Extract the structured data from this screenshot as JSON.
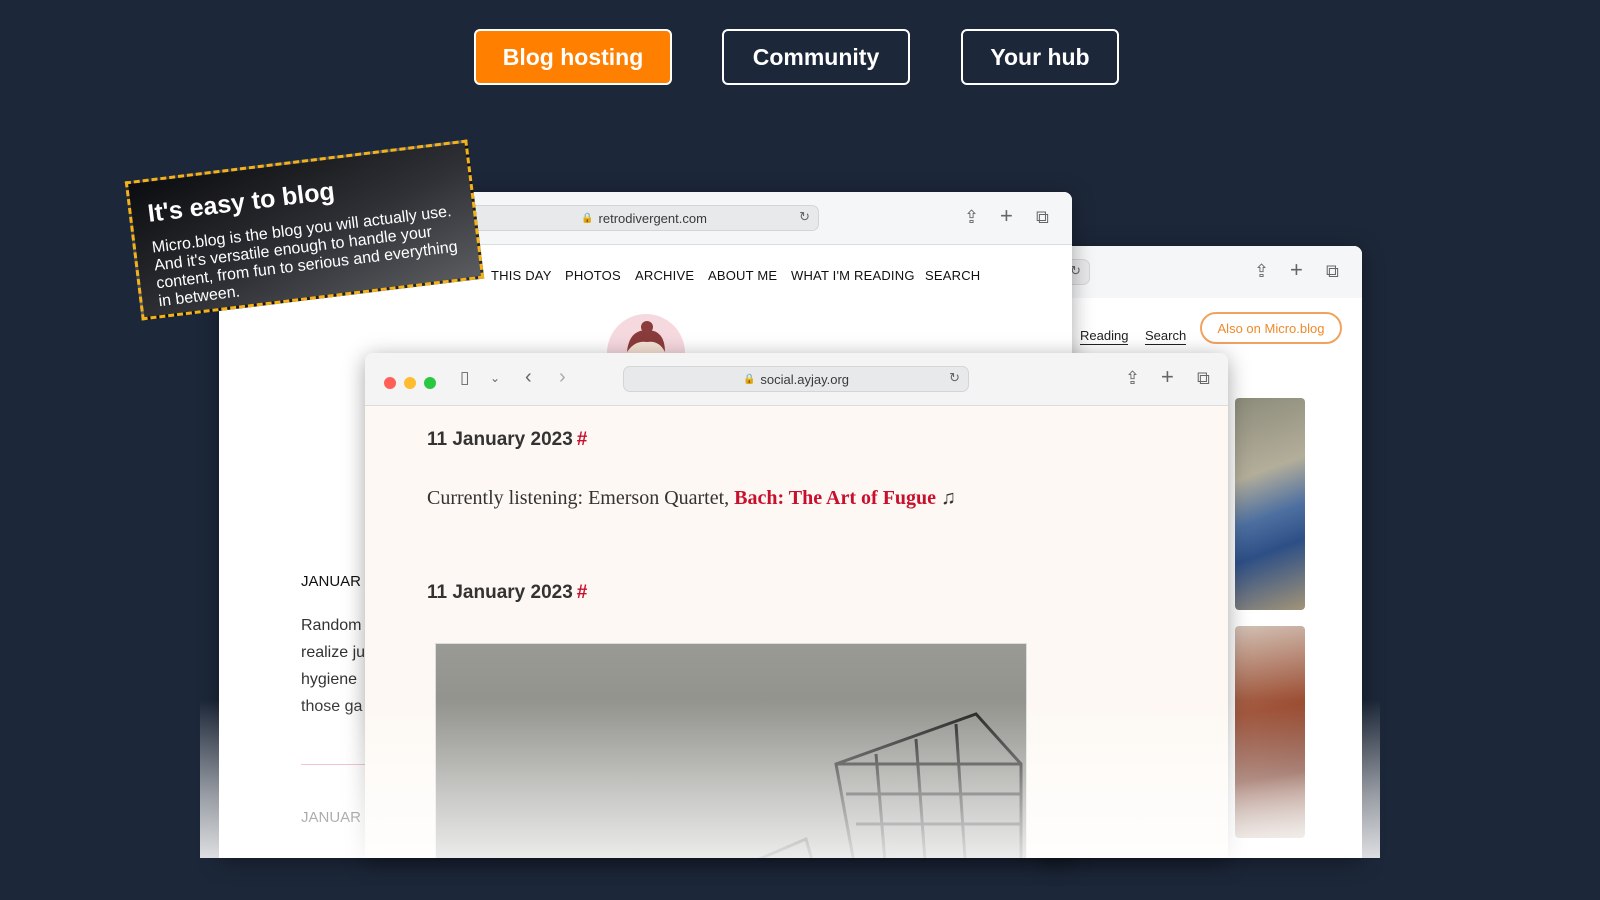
{
  "tabs": [
    {
      "label": "Blog hosting",
      "active": true
    },
    {
      "label": "Community",
      "active": false
    },
    {
      "label": "Your hub",
      "active": false
    }
  ],
  "callout": {
    "title": "It's easy to blog",
    "body": "Micro.blog is the blog you will actually use. And it's versatile enough to handle your content, from fun to serious and everything in between."
  },
  "window_retro": {
    "url": "retrodivergent.com",
    "nav": [
      "THIS DAY",
      "PHOTOS",
      "ARCHIVE",
      "ABOUT ME",
      "WHAT I'M READING",
      "SEARCH"
    ],
    "entries": [
      {
        "date": "JANUAR",
        "lines": [
          "Random",
          "realize ju",
          "hygiene",
          "those ga"
        ]
      },
      {
        "date": "JANUAR"
      }
    ]
  },
  "window_back": {
    "nav": [
      "Reading",
      "Search"
    ],
    "also_button": "Also on Micro.blog"
  },
  "window_social": {
    "url": "social.ayjay.org",
    "posts": [
      {
        "date": "11 January 2023",
        "hash": "#",
        "text_prefix": "Currently listening: Emerson Quartet, ",
        "link": "Bach: The Art of Fugue",
        "suffix": " ♫"
      },
      {
        "date": "11 January 2023",
        "hash": "#"
      }
    ]
  },
  "colors": {
    "background": "#1c2739",
    "accent": "#ff7f00",
    "link": "#c8102e",
    "dash": "#f3b21b"
  },
  "icons": {
    "share": "share-icon",
    "new_tab": "plus-icon",
    "tabs": "tabs-overview-icon",
    "reload": "reload-icon",
    "lock": "lock-icon",
    "sidebar": "sidebar-icon",
    "back": "chevron-left-icon",
    "forward": "chevron-right-icon"
  }
}
